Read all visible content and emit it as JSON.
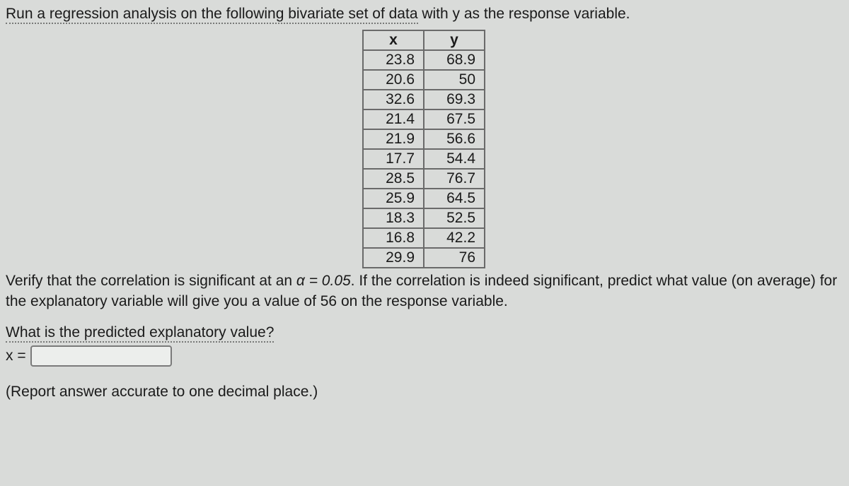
{
  "instr_line1_a": "Run a regression analysis on the following bivariate set of data",
  "instr_line1_b": " with y as the response variable.",
  "chart_data": {
    "type": "table",
    "columns": [
      "x",
      "y"
    ],
    "rows": [
      {
        "x": 23.8,
        "y": 68.9
      },
      {
        "x": 20.6,
        "y": 50
      },
      {
        "x": 32.6,
        "y": 69.3
      },
      {
        "x": 21.4,
        "y": 67.5
      },
      {
        "x": 21.9,
        "y": 56.6
      },
      {
        "x": 17.7,
        "y": 54.4
      },
      {
        "x": 28.5,
        "y": 76.7
      },
      {
        "x": 25.9,
        "y": 64.5
      },
      {
        "x": 18.3,
        "y": 52.5
      },
      {
        "x": 16.8,
        "y": 42.2
      },
      {
        "x": 29.9,
        "y": 76
      }
    ]
  },
  "instr2_a": "Verify that the correlation is significant at an ",
  "instr2_alpha": "α = 0.05",
  "instr2_b": ". If the correlation is indeed significant, predict what value (on average) for the explanatory variable will give you a value of 56 on the response variable.",
  "prompt": "What is the predicted explanatory value?",
  "answer_label": "x =",
  "answer_value": "",
  "note": "(Report answer accurate to one decimal place.)"
}
